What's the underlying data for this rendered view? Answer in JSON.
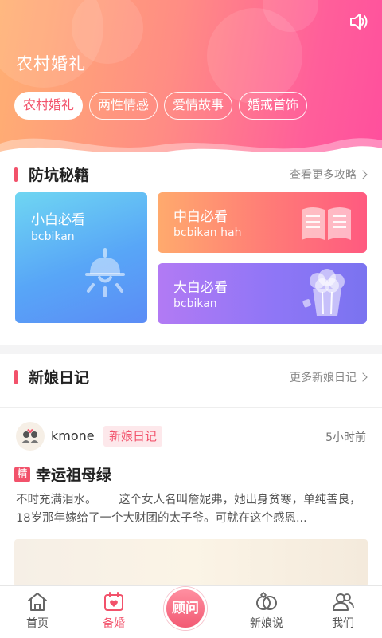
{
  "hero": {
    "title": "农村婚礼",
    "tabs": [
      "农村婚礼",
      "两性情感",
      "爱情故事",
      "婚戒首饰"
    ],
    "sound_icon": "speaker-icon"
  },
  "guides": {
    "title": "防坑秘籍",
    "more": "查看更多攻略",
    "cards": [
      {
        "title": "小白必看",
        "subtitle": "bcbikan",
        "icon": "lamp-icon"
      },
      {
        "title": "中白必看",
        "subtitle": "bcbikan hah",
        "icon": "book-icon"
      },
      {
        "title": "大白必看",
        "subtitle": "bcbikan",
        "icon": "popcorn-icon"
      }
    ]
  },
  "diary": {
    "title": "新娘日记",
    "more": "更多新娘日记",
    "post": {
      "user": "kmone",
      "badge": "新娘日记",
      "time": "5小时前",
      "tag": "精",
      "title": "幸运祖母绿",
      "body": "不时充满泪水。      这个女人名叫詹妮弗，她出身贫寒，单纯善良，18岁那年嫁给了一个大财团的太子爷。可就在这个感恩..."
    }
  },
  "nav": {
    "items": [
      {
        "label": "首页",
        "icon": "home-icon"
      },
      {
        "label": "备婚",
        "icon": "calendar-heart-icon"
      },
      {
        "label": "顾问",
        "icon": "consult-button"
      },
      {
        "label": "新娘说",
        "icon": "rings-icon"
      },
      {
        "label": "我们",
        "icon": "users-icon"
      }
    ]
  },
  "colors": {
    "accent": "#f2526b",
    "hero_start": "#ffb072",
    "hero_end": "#ff4f9d"
  }
}
